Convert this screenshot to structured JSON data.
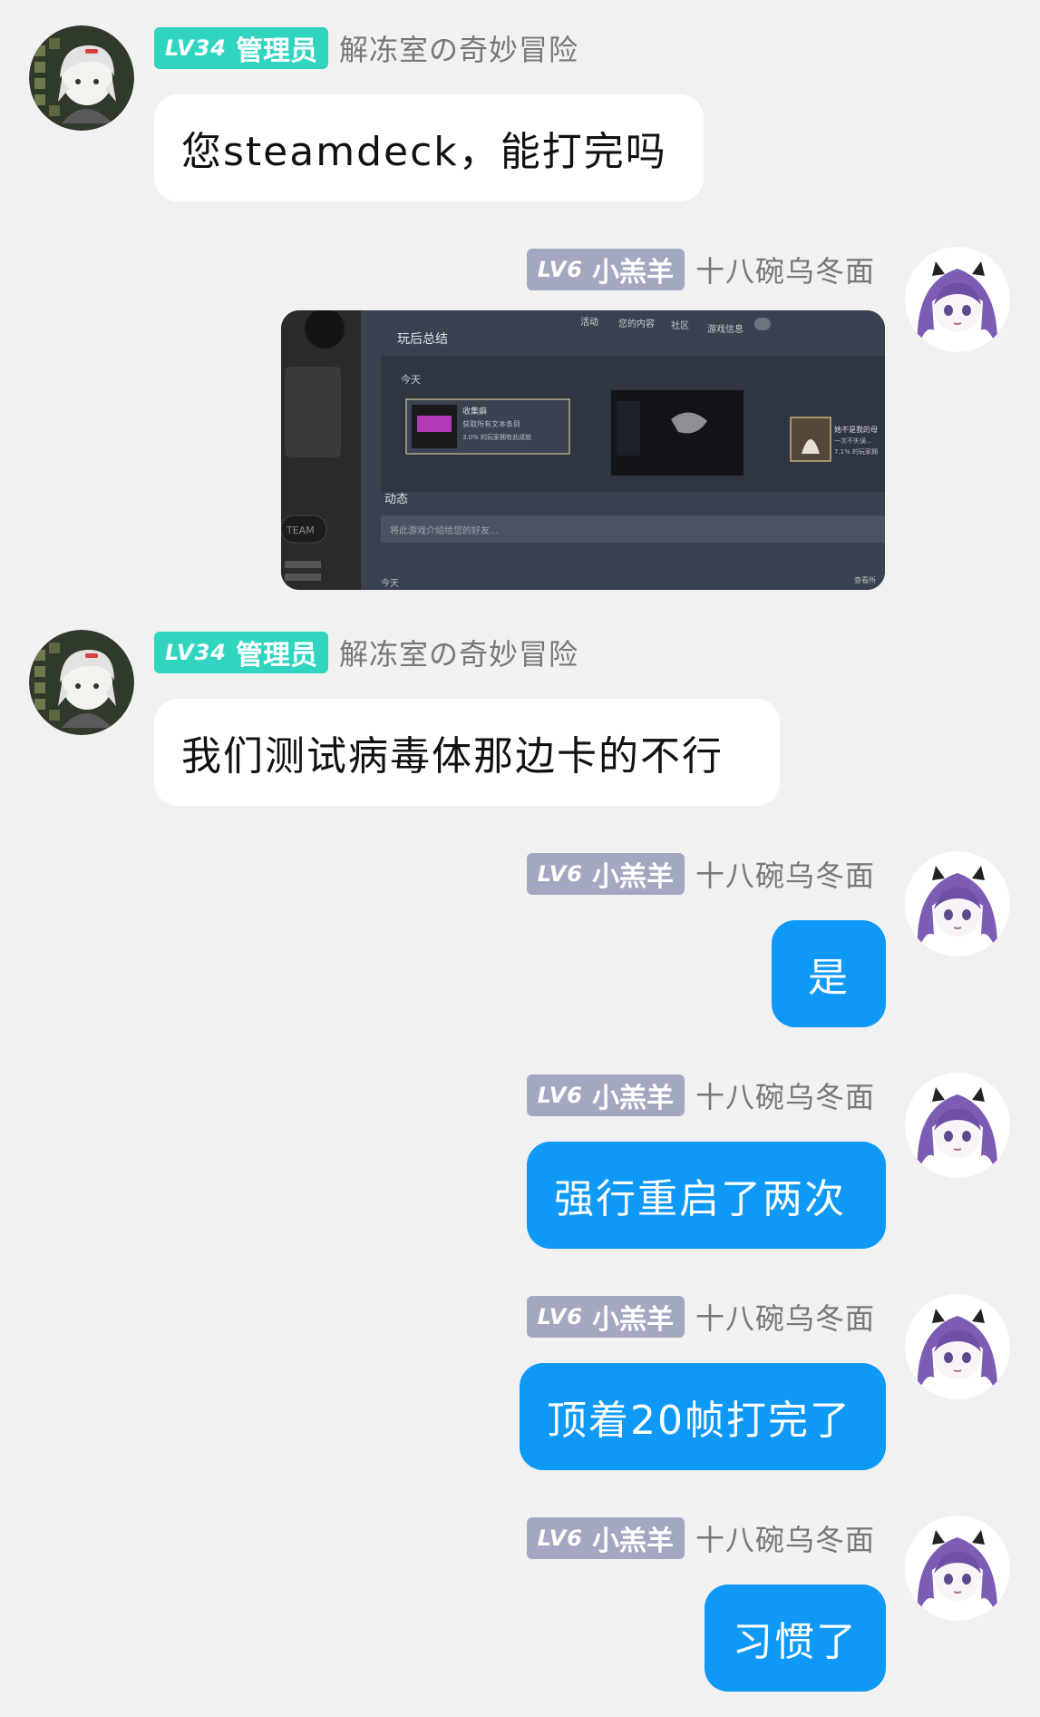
{
  "users": {
    "admin": {
      "level": "LV34",
      "title": "管理员",
      "name": "解冻室の奇妙冒险",
      "badge_color": "#30d4bf",
      "avatar": "white-hair-chibi-avatar"
    },
    "member": {
      "level": "LV6",
      "title": "小羔羊",
      "name": "十八碗乌冬面",
      "badge_color": "#a3a8c0",
      "avatar": "purple-hair-anime-avatar"
    }
  },
  "messages": [
    {
      "side": "left",
      "text": "您steamdeck，能打完吗"
    },
    {
      "side": "right",
      "type": "image",
      "image": {
        "tabs": [
          "活动",
          "您的内容",
          "社区",
          "游戏信息"
        ],
        "heading": "玩后总结",
        "today": "今天",
        "achievement_title": "收集癖",
        "achievement_desc": "获取所有文本条目",
        "achievement_percent": "3.0% 的玩家拥有此成就",
        "right_card_title": "她不是我的母",
        "right_card_desc": "一次不失误...",
        "right_card_percent": "7.1% 的玩家拥",
        "activity_heading": "动态",
        "activity_placeholder": "将此游戏介绍给您的好友...",
        "today_bottom": "今天",
        "view_all": "查看所",
        "device_label": "TEAM"
      }
    },
    {
      "side": "left",
      "text": "我们测试病毒体那边卡的不行"
    },
    {
      "side": "right",
      "text": "是"
    },
    {
      "side": "right",
      "text": "强行重启了两次"
    },
    {
      "side": "right",
      "text": "顶着20帧打完了"
    },
    {
      "side": "right",
      "text": "习惯了"
    }
  ],
  "colors": {
    "background": "#f1f1f1",
    "bubble_left": "#ffffff",
    "bubble_right": "#0f99f6",
    "nick": "#777777"
  }
}
